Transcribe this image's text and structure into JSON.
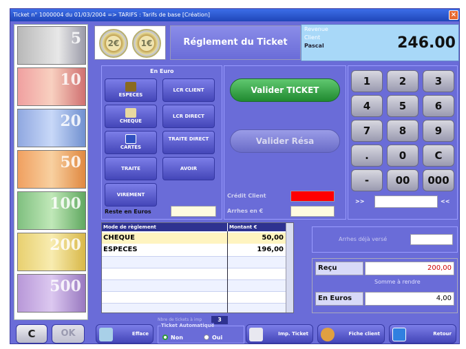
{
  "window": {
    "title": "Ticket n° 1000004 du 01/03/2004 => TARIFS : Tarifs de base [Création]"
  },
  "notes": [
    "5",
    "10",
    "20",
    "50",
    "100",
    "200",
    "500"
  ],
  "coins": [
    "2€",
    "1€"
  ],
  "header": {
    "title": "Réglement du Ticket",
    "info_line1": "Revenue",
    "info_line2": "Client",
    "info_line3": "Pascal",
    "total": "246.00"
  },
  "payment": {
    "section_title": "En Euro",
    "buttons": {
      "especes": "ESPECES",
      "lcr_client": "LCR CLIENT",
      "cheque": "CHEQUE",
      "lcr_direct": "LCR DIRECT",
      "cartes": "CARTES",
      "traite_direct": "TRAITE DIRECT",
      "traite": "TRAITE",
      "avoir": "AVOIR",
      "virement": "VIREMENT"
    },
    "reste_label": "Reste en Euros"
  },
  "actions": {
    "valider_ticket": "Valider TICKET",
    "valider_resa": "Valider Résa",
    "credit_client_label": "Crédit Client",
    "acompte_label": "Arrhes en €"
  },
  "keypad": {
    "keys": [
      "1",
      "2",
      "3",
      "4",
      "5",
      "6",
      "7",
      "8",
      "9",
      ".",
      "0",
      "C",
      "-",
      "00",
      "000"
    ],
    "arrows_left": ">>",
    "arrows_right": "<<"
  },
  "grid": {
    "columns": [
      "Mode de règlement",
      "Montant €"
    ],
    "rows": [
      {
        "mode": "CHEQUE",
        "amount": "50,00"
      },
      {
        "mode": "ESPECES",
        "amount": "196,00"
      }
    ]
  },
  "right_panel": {
    "arrhes_button": "Arrhes déjà versé",
    "recu_label": "Reçu",
    "recu_value": "200,00",
    "rendre_label": "Somme à rendre",
    "euros_label": "En Euros",
    "euros_value": "4,00"
  },
  "bottom": {
    "c_button": "C",
    "ok_button": "OK",
    "effacer": "Efface",
    "nb_tickets_label": "Nbre de tickets à imp",
    "nb_tickets_value": "3",
    "ticket_auto_label": "Ticket Automatique",
    "non_label": "Non",
    "oui_label": "Oui",
    "imp_ticket": "Imp. Ticket",
    "fiche_client": "Fiche client",
    "retour": "Retour"
  },
  "colors": {
    "window_bg": "#6a6cd8",
    "title_bar": "#2046b8",
    "valider_ticket": "#2fa040",
    "credit_client_red": "#ff0000",
    "recu_value_red": "#cc0000"
  }
}
